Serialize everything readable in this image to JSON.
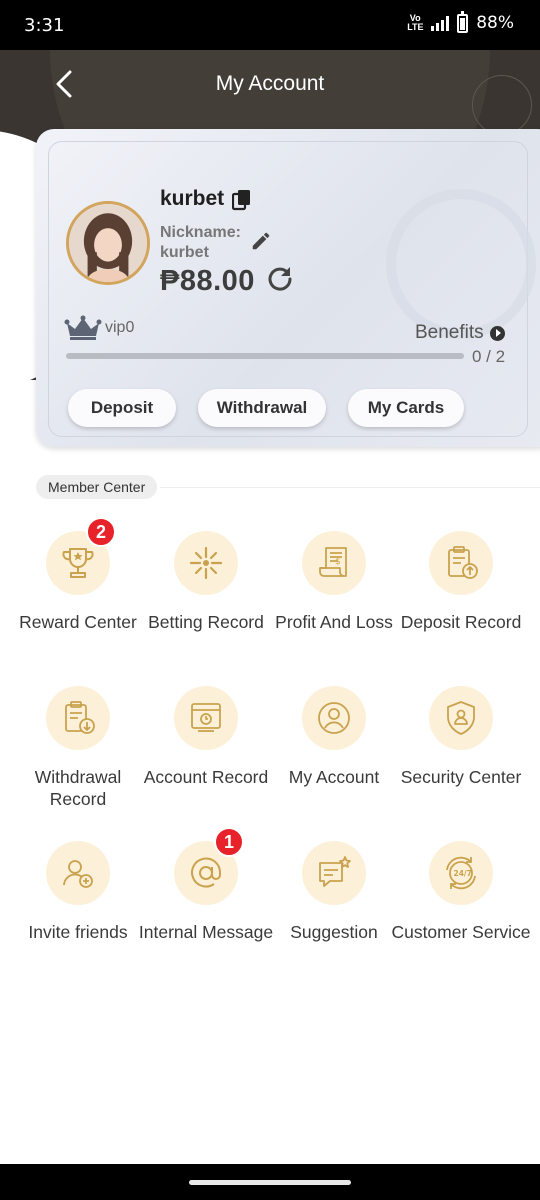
{
  "status_bar": {
    "time": "3:31",
    "network": "Vo LTE",
    "signal": "4G",
    "battery": "88%"
  },
  "header": {
    "title": "My Account",
    "back_icon": "chevron-left-icon"
  },
  "profile": {
    "username": "kurbet",
    "nickname_label": "Nickname:",
    "nickname_value": "kurbet",
    "balance": "₱88.00",
    "vip_level": "vip0",
    "benefits_label": "Benefits",
    "progress_text": "0 / 2",
    "progress_fraction": 0.0
  },
  "actions": {
    "deposit": "Deposit",
    "withdrawal": "Withdrawal",
    "my_cards": "My Cards"
  },
  "member_center": {
    "title": "Member Center",
    "items": [
      {
        "label": "Reward Center",
        "icon": "trophy-icon",
        "badge": "2"
      },
      {
        "label": "Betting Record",
        "icon": "betting-icon",
        "badge": ""
      },
      {
        "label": "Profit And Loss",
        "icon": "profit-loss-icon",
        "badge": ""
      },
      {
        "label": "Deposit Record",
        "icon": "deposit-record-icon",
        "badge": ""
      },
      {
        "label": "Withdrawal Record",
        "icon": "withdrawal-record-icon",
        "badge": ""
      },
      {
        "label": "Account Record",
        "icon": "account-record-icon",
        "badge": ""
      },
      {
        "label": "My Account",
        "icon": "user-icon",
        "badge": ""
      },
      {
        "label": "Security Center",
        "icon": "shield-icon",
        "badge": ""
      },
      {
        "label": "Invite friends",
        "icon": "invite-icon",
        "badge": ""
      },
      {
        "label": "Internal Message",
        "icon": "at-sign-icon",
        "badge": "1"
      },
      {
        "label": "Suggestion",
        "icon": "suggestion-icon",
        "badge": ""
      },
      {
        "label": "Customer Service",
        "icon": "support-24-7-icon",
        "badge": ""
      }
    ]
  },
  "colors": {
    "gold": "#d2a45c",
    "icon_bg": "#fdf0d8",
    "badge": "#e8222a",
    "header_bg": "#3a3530"
  }
}
